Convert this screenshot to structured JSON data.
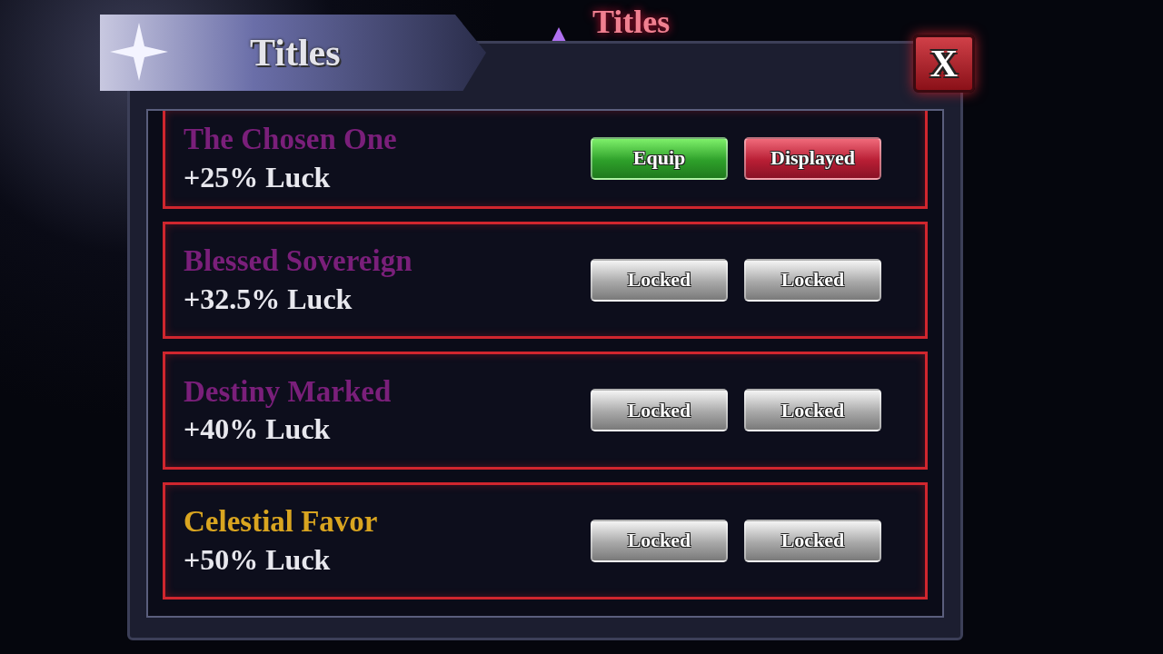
{
  "header": {
    "title": "Titles"
  },
  "background_tab": {
    "title": "Titles"
  },
  "close_button": {
    "label": "X"
  },
  "titles": [
    {
      "name": "The Chosen One",
      "color": "#7a1f7a",
      "bonus": "+25% Luck",
      "buttons": [
        {
          "kind": "equip",
          "label": "Equip"
        },
        {
          "kind": "displayed",
          "label": "Displayed"
        }
      ]
    },
    {
      "name": "Blessed Sovereign",
      "color": "#7a1f7a",
      "bonus": "+32.5% Luck",
      "buttons": [
        {
          "kind": "locked",
          "label": "Locked"
        },
        {
          "kind": "locked",
          "label": "Locked"
        }
      ]
    },
    {
      "name": "Destiny Marked",
      "color": "#7a1f7a",
      "bonus": "+40% Luck",
      "buttons": [
        {
          "kind": "locked",
          "label": "Locked"
        },
        {
          "kind": "locked",
          "label": "Locked"
        }
      ]
    },
    {
      "name": "Celestial Favor",
      "color": "#d9a520",
      "bonus": "+50% Luck",
      "buttons": [
        {
          "kind": "locked",
          "label": "Locked"
        },
        {
          "kind": "locked",
          "label": "Locked"
        }
      ]
    }
  ]
}
